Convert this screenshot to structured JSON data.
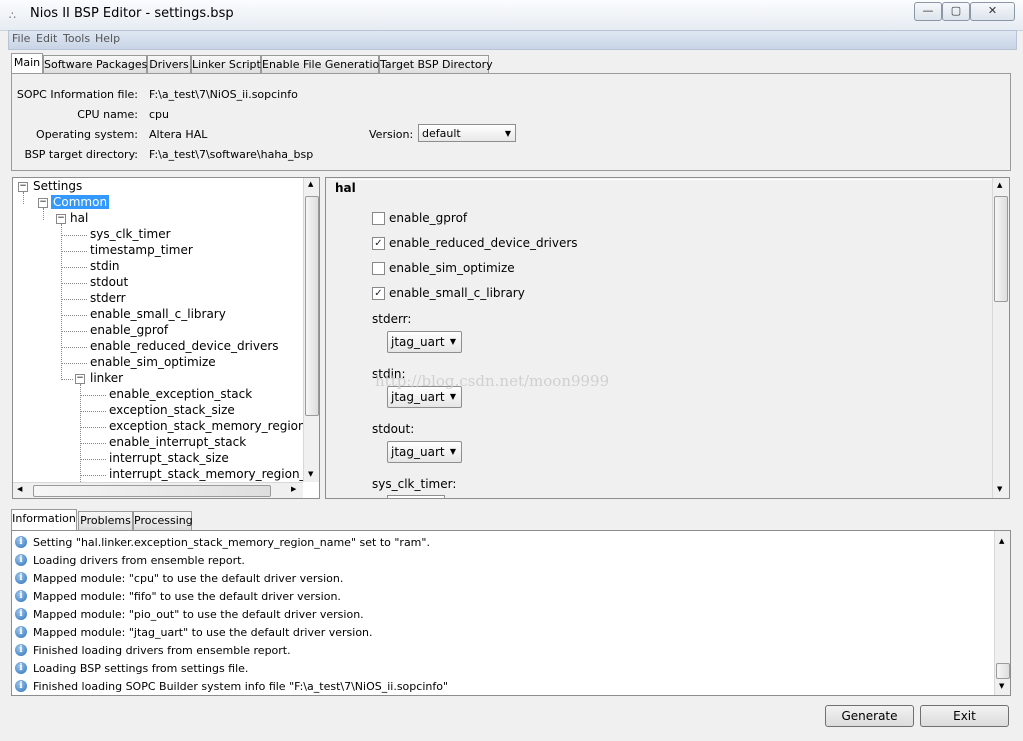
{
  "window": {
    "title": "Nios II BSP Editor - settings.bsp"
  },
  "menu": [
    "File",
    "Edit",
    "Tools",
    "Help"
  ],
  "tabs": [
    "Main",
    "Software Packages",
    "Drivers",
    "Linker Script",
    "Enable File Generation",
    "Target BSP Directory"
  ],
  "info": {
    "sopc_label": "SOPC Information file:",
    "sopc_value": "F:\\a_test\\7\\NiOS_ii.sopcinfo",
    "cpu_label": "CPU name:",
    "cpu_value": "cpu",
    "os_label": "Operating system:",
    "os_value": "Altera HAL",
    "version_label": "Version:",
    "version_value": "default",
    "bsp_label": "BSP target directory:",
    "bsp_value": "F:\\a_test\\7\\software\\haha_bsp"
  },
  "tree": {
    "root": "Settings",
    "common": "Common",
    "hal": "hal",
    "hal_children": [
      "sys_clk_timer",
      "timestamp_timer",
      "stdin",
      "stdout",
      "stderr",
      "enable_small_c_library",
      "enable_gprof",
      "enable_reduced_device_drivers",
      "enable_sim_optimize"
    ],
    "linker": "linker",
    "linker_children": [
      "enable_exception_stack",
      "exception_stack_size",
      "exception_stack_memory_region_n",
      "enable_interrupt_stack",
      "interrupt_stack_size",
      "interrupt_stack_memory_region_na"
    ]
  },
  "settings": {
    "header": "hal",
    "checkboxes": [
      {
        "label": "enable_gprof",
        "checked": false
      },
      {
        "label": "enable_reduced_device_drivers",
        "checked": true
      },
      {
        "label": "enable_sim_optimize",
        "checked": false
      },
      {
        "label": "enable_small_c_library",
        "checked": true
      }
    ],
    "stderr_label": "stderr:",
    "stderr_value": "jtag_uart",
    "stdin_label": "stdin:",
    "stdin_value": "jtag_uart",
    "stdout_label": "stdout:",
    "stdout_value": "jtag_uart",
    "sysclk_label": "sys_clk_timer:"
  },
  "watermark": "http://blog.csdn.net/moon9999",
  "bottom_tabs": [
    "Information",
    "Problems",
    "Processing"
  ],
  "log": [
    "Setting \"hal.linker.exception_stack_memory_region_name\" set to \"ram\".",
    "Loading drivers from ensemble report.",
    "Mapped module: \"cpu\" to use the default driver version.",
    "Mapped module: \"fifo\" to use the default driver version.",
    "Mapped module: \"pio_out\" to use the default driver version.",
    "Mapped module: \"jtag_uart\" to use the default driver version.",
    "Finished loading drivers from ensemble report.",
    "Loading BSP settings from settings file.",
    "Finished loading SOPC Builder system info file \"F:\\a_test\\7\\NiOS_ii.sopcinfo\""
  ],
  "buttons": {
    "generate": "Generate",
    "exit": "Exit"
  },
  "icons": {
    "minimize": "minimize-icon",
    "maximize": "maximize-icon",
    "close": "close-icon",
    "info": "info-icon",
    "dropdown": "chevron-down-icon"
  }
}
